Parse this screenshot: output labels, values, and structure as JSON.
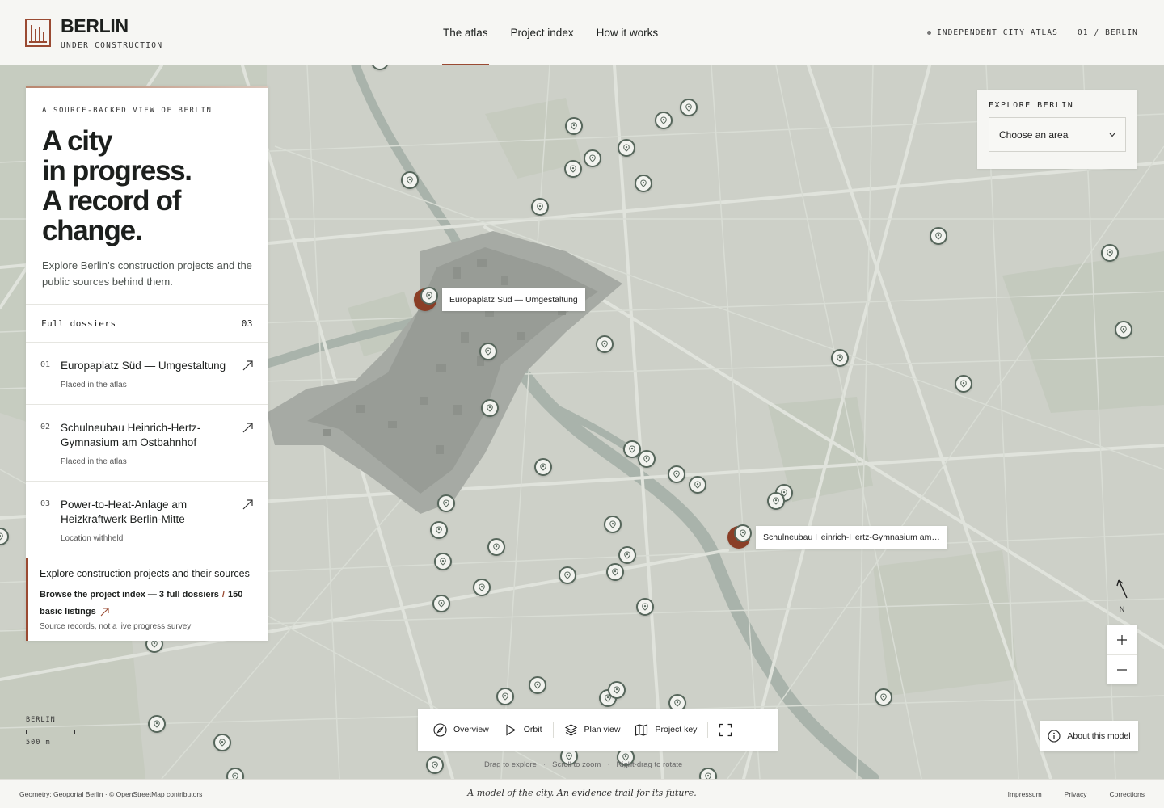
{
  "header": {
    "brand_title": "BERLIN",
    "brand_subtitle": "UNDER CONSTRUCTION",
    "nav": [
      {
        "label": "The atlas",
        "active": true
      },
      {
        "label": "Project index",
        "active": false
      },
      {
        "label": "How it works",
        "active": false
      }
    ],
    "tagline": "INDEPENDENT CITY ATLAS",
    "edition": "01 / BERLIN"
  },
  "panel": {
    "eyebrow": "A SOURCE-BACKED VIEW OF BERLIN",
    "headline": [
      "A city",
      "in progress.",
      "A record of",
      "change."
    ],
    "intro": "Explore Berlin’s construction projects and the public sources behind them.",
    "dossiers_label": "Full dossiers",
    "dossiers_count": "03",
    "dossiers": [
      {
        "num": "01",
        "title": "Europaplatz Süd — Umgestaltung",
        "status": "Placed in the atlas"
      },
      {
        "num": "02",
        "title": "Schulneubau Heinrich-Hertz-Gymnasium am Ostbahnhof",
        "status": "Placed in the atlas"
      },
      {
        "num": "03",
        "title": "Power-to-Heat-Anlage am Heizkraftwerk Berlin-Mitte",
        "status": "Location withheld"
      }
    ],
    "cta_title": "Explore construction projects and their sources",
    "cta_link_a": "Browse the project index — 3 full dossiers",
    "cta_link_sep": "/",
    "cta_link_b": "150 basic listings",
    "cta_note": "Source records, not a live progress survey"
  },
  "explore": {
    "label": "EXPLORE BERLIN",
    "select_value": "Choose an area"
  },
  "map": {
    "labels": [
      "Europaplatz Süd — Umgestaltung",
      "Schulneubau Heinrich-Hertz-Gymnasium am…"
    ],
    "compass": "N",
    "scale_title": "BERLIN",
    "scale_value": "500 m",
    "colors": {
      "pin_border": "#56665b",
      "featured": "#8a3e26",
      "accent": "#9a4a32"
    }
  },
  "toolbar": {
    "items": [
      {
        "label": "Overview",
        "icon": "compass-icon"
      },
      {
        "label": "Orbit",
        "icon": "play-icon"
      },
      {
        "label": "Plan view",
        "icon": "layers-icon"
      },
      {
        "label": "Project key",
        "icon": "map-icon"
      }
    ],
    "fullscreen_icon": "fullscreen-icon",
    "hints": [
      "Drag to explore",
      "Scroll to zoom",
      "Right-drag to rotate"
    ]
  },
  "about_label": "About this model",
  "footer": {
    "credits": "Geometry: Geoportal Berlin · © OpenStreetMap contributors",
    "motto": "A model of the city. An evidence trail for its future.",
    "links": [
      "Impressum",
      "Privacy",
      "Corrections"
    ]
  }
}
